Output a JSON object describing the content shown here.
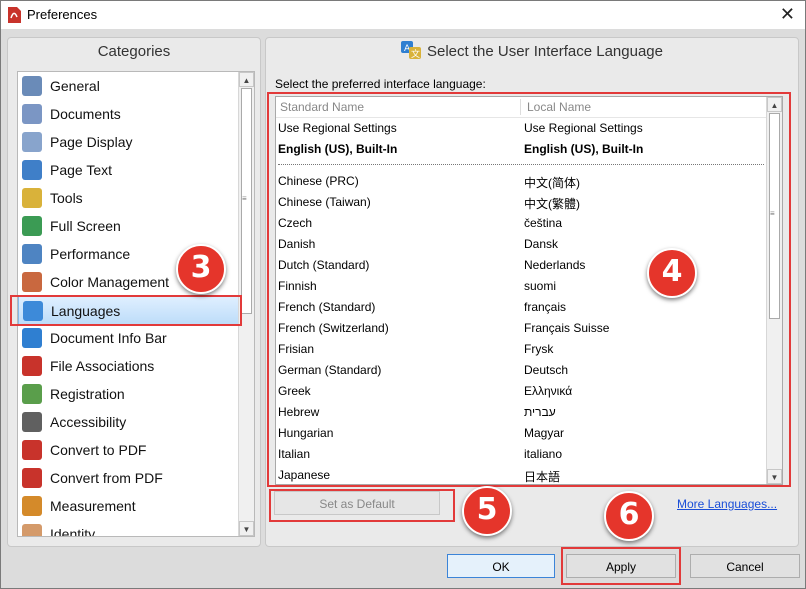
{
  "window": {
    "title": "Preferences"
  },
  "categories": {
    "heading": "Categories",
    "items": [
      {
        "label": "General",
        "icon": "general-icon",
        "color": "#6a8bb8"
      },
      {
        "label": "Documents",
        "icon": "documents-icon",
        "color": "#7b96c4"
      },
      {
        "label": "Page Display",
        "icon": "page-display-icon",
        "color": "#88a4cc"
      },
      {
        "label": "Page Text",
        "icon": "page-text-icon",
        "color": "#3f7fc8"
      },
      {
        "label": "Tools",
        "icon": "tools-icon",
        "color": "#d9b23a"
      },
      {
        "label": "Full Screen",
        "icon": "full-screen-icon",
        "color": "#3b9b54"
      },
      {
        "label": "Performance",
        "icon": "performance-icon",
        "color": "#4e84c2"
      },
      {
        "label": "Color Management",
        "icon": "color-management-icon",
        "color": "#c9683f"
      },
      {
        "label": "Languages",
        "icon": "languages-icon",
        "color": "#3d8ad9"
      },
      {
        "label": "Document Info Bar",
        "icon": "info-icon",
        "color": "#2f7fd1"
      },
      {
        "label": "File Associations",
        "icon": "pdf-icon",
        "color": "#c8332b"
      },
      {
        "label": "Registration",
        "icon": "registration-icon",
        "color": "#5a9e4b"
      },
      {
        "label": "Accessibility",
        "icon": "accessibility-icon",
        "color": "#606060"
      },
      {
        "label": "Convert to PDF",
        "icon": "convert-to-pdf-icon",
        "color": "#c8332b"
      },
      {
        "label": "Convert from PDF",
        "icon": "convert-from-pdf-icon",
        "color": "#c8332b"
      },
      {
        "label": "Measurement",
        "icon": "measurement-icon",
        "color": "#d48a2a"
      },
      {
        "label": "Identity",
        "icon": "identity-icon",
        "color": "#d49a6a"
      }
    ],
    "selected_index": 8
  },
  "language": {
    "heading": "Select the User Interface Language",
    "prompt": "Select the preferred interface language:",
    "col_standard": "Standard Name",
    "col_local": "Local Name",
    "rows": [
      {
        "std": "Use Regional Settings",
        "local": "Use Regional Settings",
        "bold": false
      },
      {
        "std": "English (US), Built-In",
        "local": "English (US), Built-In",
        "bold": true
      },
      {
        "std": "Chinese (PRC)",
        "local": "中文(简体)",
        "bold": false
      },
      {
        "std": "Chinese (Taiwan)",
        "local": "中文(繁體)",
        "bold": false
      },
      {
        "std": "Czech",
        "local": "čeština",
        "bold": false
      },
      {
        "std": "Danish",
        "local": "Dansk",
        "bold": false
      },
      {
        "std": "Dutch (Standard)",
        "local": "Nederlands",
        "bold": false
      },
      {
        "std": "Finnish",
        "local": "suomi",
        "bold": false
      },
      {
        "std": "French (Standard)",
        "local": "français",
        "bold": false
      },
      {
        "std": "French (Switzerland)",
        "local": "Français Suisse",
        "bold": false
      },
      {
        "std": "Frisian",
        "local": "Frysk",
        "bold": false
      },
      {
        "std": "German (Standard)",
        "local": "Deutsch",
        "bold": false
      },
      {
        "std": "Greek",
        "local": "Ελληνικά",
        "bold": false
      },
      {
        "std": "Hebrew",
        "local": "עברית",
        "bold": false
      },
      {
        "std": "Hungarian",
        "local": "Magyar",
        "bold": false
      },
      {
        "std": "Italian",
        "local": "italiano",
        "bold": false
      },
      {
        "std": "Japanese",
        "local": "日本語",
        "bold": false
      }
    ],
    "set_default": "Set as Default",
    "more_languages": "More Languages..."
  },
  "footer": {
    "ok": "OK",
    "apply": "Apply",
    "cancel": "Cancel"
  },
  "callouts": [
    "3",
    "4",
    "5",
    "6"
  ],
  "accent": "#e5352b"
}
